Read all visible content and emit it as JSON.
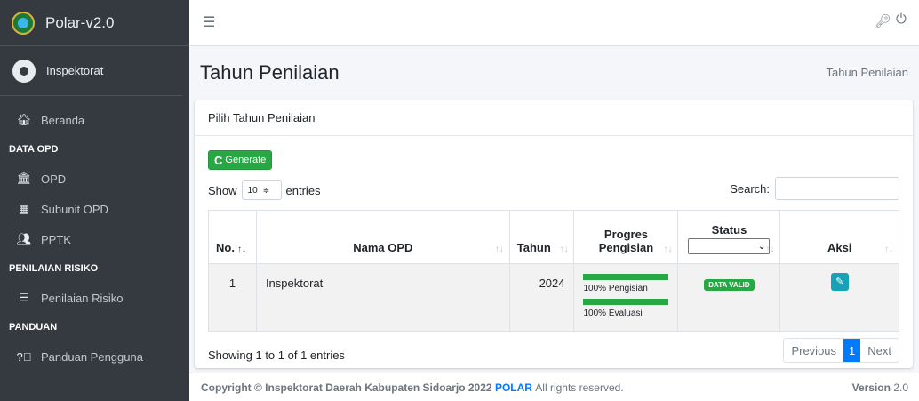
{
  "app": {
    "title": "Polar-v2.0",
    "user": "Inspektorat"
  },
  "sidebar": {
    "beranda": "Beranda",
    "section_data_opd": "DATA OPD",
    "opd": "OPD",
    "subunit": "Subunit OPD",
    "pptk": "PPTK",
    "section_risiko": "PENILAIAN RISIKO",
    "penilaian": "Penilaian Risiko",
    "section_panduan": "PANDUAN",
    "panduan": "Panduan Pengguna"
  },
  "header": {
    "title": "Tahun Penilaian",
    "breadcrumb": "Tahun Penilaian"
  },
  "card": {
    "title": "Pilih Tahun Penilaian",
    "generate": "Generate",
    "show": "Show",
    "entries_value": "10",
    "entries": "entries",
    "search_label": "Search:",
    "search_value": ""
  },
  "table": {
    "headers": {
      "no": "No.",
      "nama": "Nama OPD",
      "tahun": "Tahun",
      "progres_1": "Progres",
      "progres_2": "Pengisian",
      "status": "Status",
      "aksi": "Aksi"
    },
    "rows": [
      {
        "no": "1",
        "nama": "Inspektorat",
        "tahun": "2024",
        "pengisian": "100% Pengisian",
        "evaluasi": "100% Evaluasi",
        "pengisian_pct": 100,
        "evaluasi_pct": 100,
        "status": "DATA VALID"
      }
    ]
  },
  "footer": {
    "showing": "Showing 1 to 1 of 1 entries",
    "previous": "Previous",
    "page": "1",
    "next": "Next",
    "copyright": "Copyright © Inspektorat Daerah Kabupaten Sidoarjo 2022",
    "brand": "POLAR",
    "rights": "All rights reserved.",
    "version_label": "Version",
    "version": "2.0"
  },
  "colors": {
    "sidebar": "#343a40",
    "success": "#28a745",
    "info": "#17a2b8",
    "primary": "#007bff"
  }
}
